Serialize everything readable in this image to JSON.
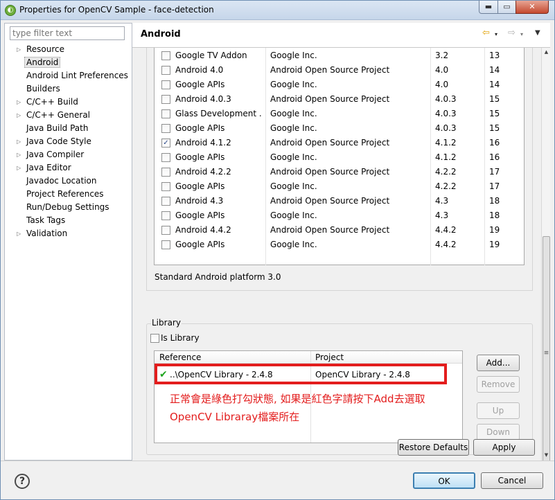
{
  "window": {
    "title": "Properties for OpenCV Sample - face-detection",
    "min_symbol": "▬",
    "max_symbol": "▭",
    "close_symbol": "✕",
    "app_icon": "eclipse-icon"
  },
  "sidebar": {
    "filter_placeholder": "type filter text",
    "items": [
      {
        "label": "Resource",
        "expandable": true
      },
      {
        "label": "Android",
        "expandable": false,
        "selected": true
      },
      {
        "label": "Android Lint Preferences",
        "expandable": false
      },
      {
        "label": "Builders",
        "expandable": false
      },
      {
        "label": "C/C++ Build",
        "expandable": true
      },
      {
        "label": "C/C++ General",
        "expandable": true
      },
      {
        "label": "Java Build Path",
        "expandable": false
      },
      {
        "label": "Java Code Style",
        "expandable": true
      },
      {
        "label": "Java Compiler",
        "expandable": true
      },
      {
        "label": "Java Editor",
        "expandable": true
      },
      {
        "label": "Javadoc Location",
        "expandable": false
      },
      {
        "label": "Project References",
        "expandable": false
      },
      {
        "label": "Run/Debug Settings",
        "expandable": false
      },
      {
        "label": "Task Tags",
        "expandable": false
      },
      {
        "label": "Validation",
        "expandable": true
      }
    ]
  },
  "header": {
    "title": "Android",
    "back_icon": "⇦",
    "forward_icon": "⇨",
    "menu_icon": "▾"
  },
  "targets": {
    "rows": [
      {
        "name": "Google TV Addon",
        "vendor": "Google Inc.",
        "version": "3.2",
        "api": "13",
        "checked": false
      },
      {
        "name": "Android 4.0",
        "vendor": "Android Open Source Project",
        "version": "4.0",
        "api": "14",
        "checked": false
      },
      {
        "name": "Google APIs",
        "vendor": "Google Inc.",
        "version": "4.0",
        "api": "14",
        "checked": false
      },
      {
        "name": "Android 4.0.3",
        "vendor": "Android Open Source Project",
        "version": "4.0.3",
        "api": "15",
        "checked": false
      },
      {
        "name": "Glass Development ...",
        "vendor": "Google Inc.",
        "version": "4.0.3",
        "api": "15",
        "checked": false
      },
      {
        "name": "Google APIs",
        "vendor": "Google Inc.",
        "version": "4.0.3",
        "api": "15",
        "checked": false
      },
      {
        "name": "Android 4.1.2",
        "vendor": "Android Open Source Project",
        "version": "4.1.2",
        "api": "16",
        "checked": true
      },
      {
        "name": "Google APIs",
        "vendor": "Google Inc.",
        "version": "4.1.2",
        "api": "16",
        "checked": false
      },
      {
        "name": "Android 4.2.2",
        "vendor": "Android Open Source Project",
        "version": "4.2.2",
        "api": "17",
        "checked": false
      },
      {
        "name": "Google APIs",
        "vendor": "Google Inc.",
        "version": "4.2.2",
        "api": "17",
        "checked": false
      },
      {
        "name": "Android 4.3",
        "vendor": "Android Open Source Project",
        "version": "4.3",
        "api": "18",
        "checked": false
      },
      {
        "name": "Google APIs",
        "vendor": "Google Inc.",
        "version": "4.3",
        "api": "18",
        "checked": false
      },
      {
        "name": "Android 4.4.2",
        "vendor": "Android Open Source Project",
        "version": "4.4.2",
        "api": "19",
        "checked": false
      },
      {
        "name": "Google APIs",
        "vendor": "Google Inc.",
        "version": "4.4.2",
        "api": "19",
        "checked": false
      }
    ],
    "description": "Standard Android platform 3.0"
  },
  "library": {
    "legend": "Library",
    "is_library_label": "Is Library",
    "is_library_checked": false,
    "col_reference": "Reference",
    "col_project": "Project",
    "rows": [
      {
        "reference": "..\\OpenCV Library - 2.4.8",
        "project": "OpenCV Library - 2.4.8",
        "status_icon": "green-check-icon"
      }
    ],
    "buttons": {
      "add": "Add...",
      "remove": "Remove",
      "up": "Up",
      "down": "Down"
    },
    "note_line1": "正常會是綠色打勾狀態, 如果是紅色字請按下Add去選取",
    "note_line2": "OpenCV Libraray檔案所在"
  },
  "actions": {
    "restore_defaults": "Restore Defaults",
    "apply": "Apply"
  },
  "footer": {
    "help": "?",
    "ok": "OK",
    "cancel": "Cancel"
  },
  "colors": {
    "highlight_red": "#e31d1d",
    "check_green": "#1fa51f",
    "ok_border": "#3c7fb1"
  }
}
